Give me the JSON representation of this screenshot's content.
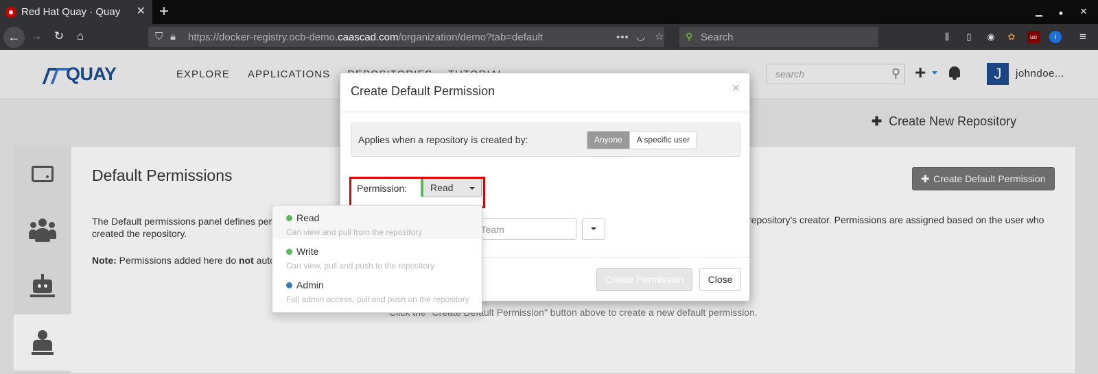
{
  "browser": {
    "tab_title": "Red Hat Quay · Quay",
    "url_prefix": "https://docker-registry.ocb-demo.",
    "url_domain": "caascad.com",
    "url_suffix": "/organization/demo?tab=default",
    "url_more": "•••",
    "search_placeholder": "Search"
  },
  "header": {
    "logo_text": "QUAY",
    "nav": [
      "EXPLORE",
      "APPLICATIONS",
      "REPOSITORIES",
      "TUTORIAL"
    ],
    "search_placeholder": "search",
    "avatar_letter": "J",
    "username": "johndoe..."
  },
  "page": {
    "create_repo_label": "Create New Repository",
    "title": "Default Permissions",
    "desc_start": "The Default permissions panel defines per",
    "desc_end": "repository's creator. Permissions are assigned based on the user who",
    "desc_line2": "created the repository.",
    "note_label": "Note:",
    "note_text": " Permissions added here do ",
    "note_bold": "not",
    "note_tail": " auto",
    "create_default_label": "Create Default Permission",
    "empty_message": "Click the \"Create Default Permission\" button above to create a new default permission."
  },
  "modal": {
    "title": "Create Default Permission",
    "close_glyph": "×",
    "applies_label": "Applies when a repository is created by:",
    "applies_options": [
      "Anyone",
      "A specific user"
    ],
    "applies_selected": "Anyone",
    "permission_label": "Permission:",
    "permission_value": "Read",
    "entity_placeholder": "ot/Team",
    "create_button": "Create Permission",
    "close_button": "Close"
  },
  "permission_options": [
    {
      "name": "Read",
      "description": "Can view and pull from the repository",
      "color": "#5cb85c"
    },
    {
      "name": "Write",
      "description": "Can view, pull and push to the repository",
      "color": "#5cb85c"
    },
    {
      "name": "Admin",
      "description": "Full admin access, pull and push on the repository",
      "color": "#337ab7"
    }
  ],
  "colors": {
    "highlight": "#e00000",
    "brand": "#1d4f91"
  }
}
